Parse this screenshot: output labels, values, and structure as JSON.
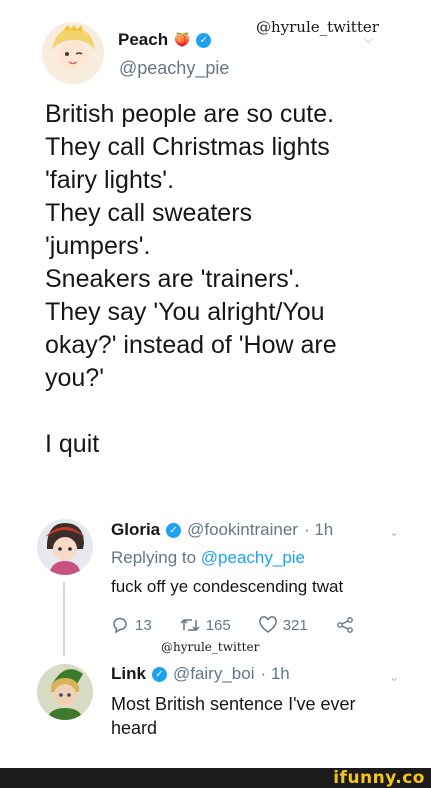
{
  "watermark": "@hyrule_twitter",
  "main_tweet": {
    "name": "Peach",
    "name_emoji": "🍑",
    "handle": "@peachy_pie",
    "lines": [
      "British people are so cute.",
      "They call Christmas lights",
      "'fairy lights'.",
      "They call sweaters",
      "'jumpers'.",
      "Sneakers are 'trainers'.",
      "They say 'You alright/You",
      "okay?' instead of 'How are",
      "you?'",
      "",
      "I quit"
    ]
  },
  "reply1": {
    "name": "Gloria",
    "handle": "@fookintrainer",
    "time": "· 1h",
    "replying_prefix": "Replying to",
    "replying_to": "@peachy_pie",
    "text": "fuck off ye condescending twat",
    "replies": "13",
    "retweets": "165",
    "likes": "321",
    "watermark": "@hyrule_twitter"
  },
  "reply2": {
    "name": "Link",
    "handle": "@fairy_boi",
    "time": "· 1h",
    "text_line1": "Most British sentence I've ever",
    "text_line2": "heard"
  },
  "footer": {
    "brand": "ifunny.co"
  },
  "colors": {
    "verified": "#1da1f2",
    "link": "#1da1f2",
    "muted": "#657786",
    "brand": "#f5c518"
  }
}
